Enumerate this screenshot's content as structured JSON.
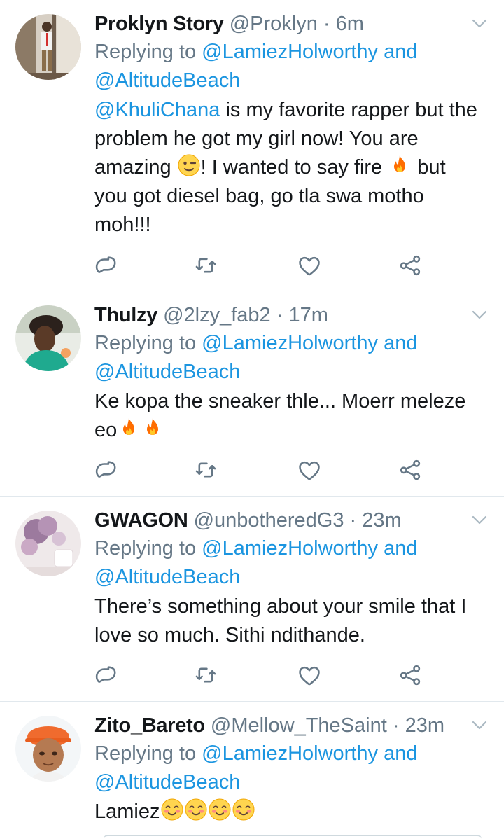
{
  "tweets": [
    {
      "name": "Proklyn Story",
      "handle": "@Proklyn",
      "sep": " · ",
      "time": "6m",
      "replying_prefix": "Replying to ",
      "reply_to_1": "@LamiezHolworthy",
      "reply_and": " and",
      "reply_to_2": "@AltitudeBeach",
      "mention": "@KhuliChana",
      "text_a": " is my favorite rapper but the problem he got my girl now! You are amazing ",
      "text_b": "! I wanted to say fire ",
      "text_c": " but you got diesel bag, go tla swa motho moh!!!"
    },
    {
      "name": "Thulzy",
      "handle": "@2lzy_fab2",
      "sep": " · ",
      "time": "17m",
      "replying_prefix": "Replying to ",
      "reply_to_1": "@LamiezHolworthy",
      "reply_and": " and",
      "reply_to_2": "@AltitudeBeach",
      "text_a": "Ke kopa the sneaker thle... Moerr meleze eo"
    },
    {
      "name": "GWAGON",
      "handle": "@unbotheredG3",
      "sep": " · ",
      "time": "23m",
      "replying_prefix": "Replying to ",
      "reply_to_1": "@LamiezHolworthy",
      "reply_and": " and",
      "reply_to_2": "@AltitudeBeach",
      "text_a": "There’s something about your smile that I love so much. Sithi ndithande."
    },
    {
      "name": "Zito_Bareto",
      "handle": "@Mellow_TheSaint",
      "sep": " · ",
      "time": "23m",
      "replying_prefix": "Replying to ",
      "reply_to_1": "@LamiezHolworthy",
      "reply_and": " and",
      "reply_to_2": "@AltitudeBeach",
      "text_a": "Lamiez"
    }
  ],
  "icons": {
    "reply": "reply-icon",
    "retweet": "retweet-icon",
    "like": "heart-icon",
    "share": "share-icon",
    "menu": "chevron-down-icon"
  },
  "colors": {
    "link": "#1b95e0",
    "secondary": "#657786",
    "text": "#14171a",
    "divider": "#e1e8ed"
  }
}
